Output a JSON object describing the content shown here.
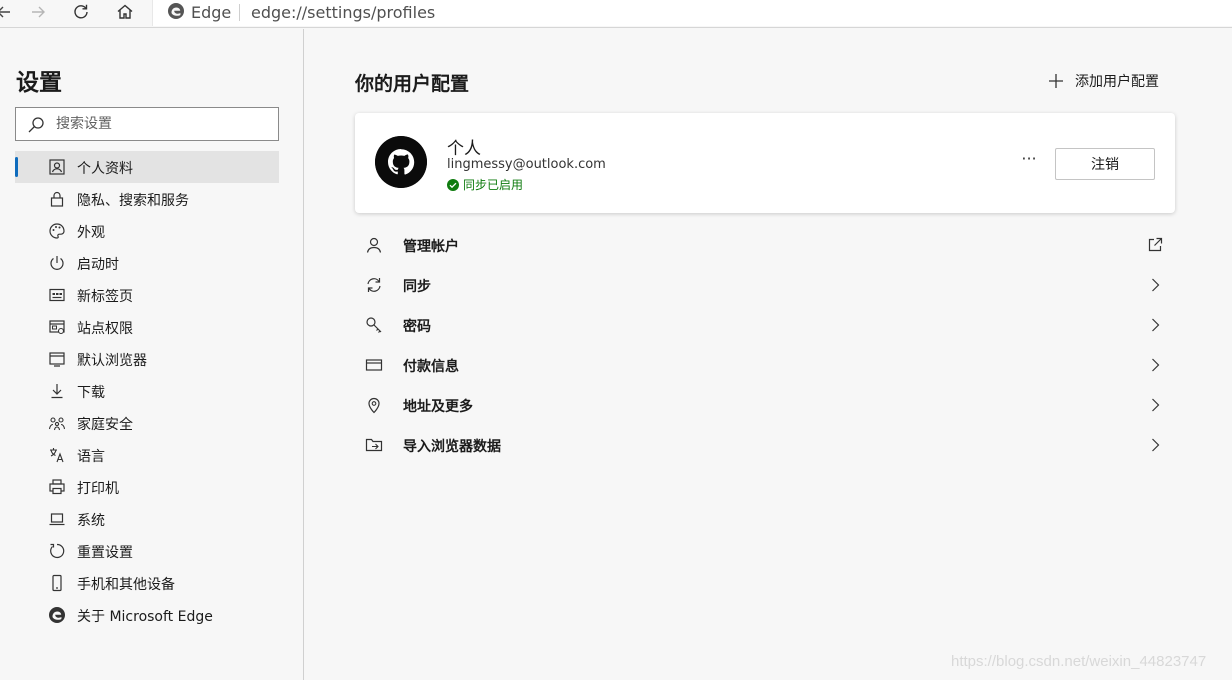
{
  "browser": {
    "brand": "Edge",
    "url": "edge://settings/profiles"
  },
  "sidebar": {
    "title": "设置",
    "search_placeholder": "搜索设置",
    "items": [
      {
        "label": "个人资料",
        "icon": "profile-icon",
        "active": true
      },
      {
        "label": "隐私、搜索和服务",
        "icon": "lock-icon"
      },
      {
        "label": "外观",
        "icon": "palette-icon"
      },
      {
        "label": "启动时",
        "icon": "power-icon"
      },
      {
        "label": "新标签页",
        "icon": "new-tab-icon"
      },
      {
        "label": "站点权限",
        "icon": "site-permissions-icon"
      },
      {
        "label": "默认浏览器",
        "icon": "browser-icon"
      },
      {
        "label": "下载",
        "icon": "download-icon"
      },
      {
        "label": "家庭安全",
        "icon": "family-icon"
      },
      {
        "label": "语言",
        "icon": "language-icon"
      },
      {
        "label": "打印机",
        "icon": "printer-icon"
      },
      {
        "label": "系统",
        "icon": "system-icon"
      },
      {
        "label": "重置设置",
        "icon": "reset-icon"
      },
      {
        "label": "手机和其他设备",
        "icon": "phone-icon"
      },
      {
        "label": "关于 Microsoft Edge",
        "icon": "edge-icon"
      }
    ]
  },
  "main": {
    "title": "你的用户配置",
    "add_profile_label": "添加用户配置",
    "profile": {
      "name": "个人",
      "email": "lingmessy@outlook.com",
      "sync_status": "同步已启用",
      "more": "···",
      "sign_out_label": "注销"
    },
    "rows": [
      {
        "label": "管理帐户",
        "icon": "person-icon",
        "end": "external-link-icon"
      },
      {
        "label": "同步",
        "icon": "sync-icon",
        "end": "chevron-right-icon"
      },
      {
        "label": "密码",
        "icon": "key-icon",
        "end": "chevron-right-icon"
      },
      {
        "label": "付款信息",
        "icon": "card-icon",
        "end": "chevron-right-icon"
      },
      {
        "label": "地址及更多",
        "icon": "location-icon",
        "end": "chevron-right-icon"
      },
      {
        "label": "导入浏览器数据",
        "icon": "import-icon",
        "end": "chevron-right-icon"
      }
    ]
  },
  "watermark": "https://blog.csdn.net/weixin_44823747",
  "colors": {
    "accent": "#0f6cbd",
    "sync_green": "#107c10"
  }
}
